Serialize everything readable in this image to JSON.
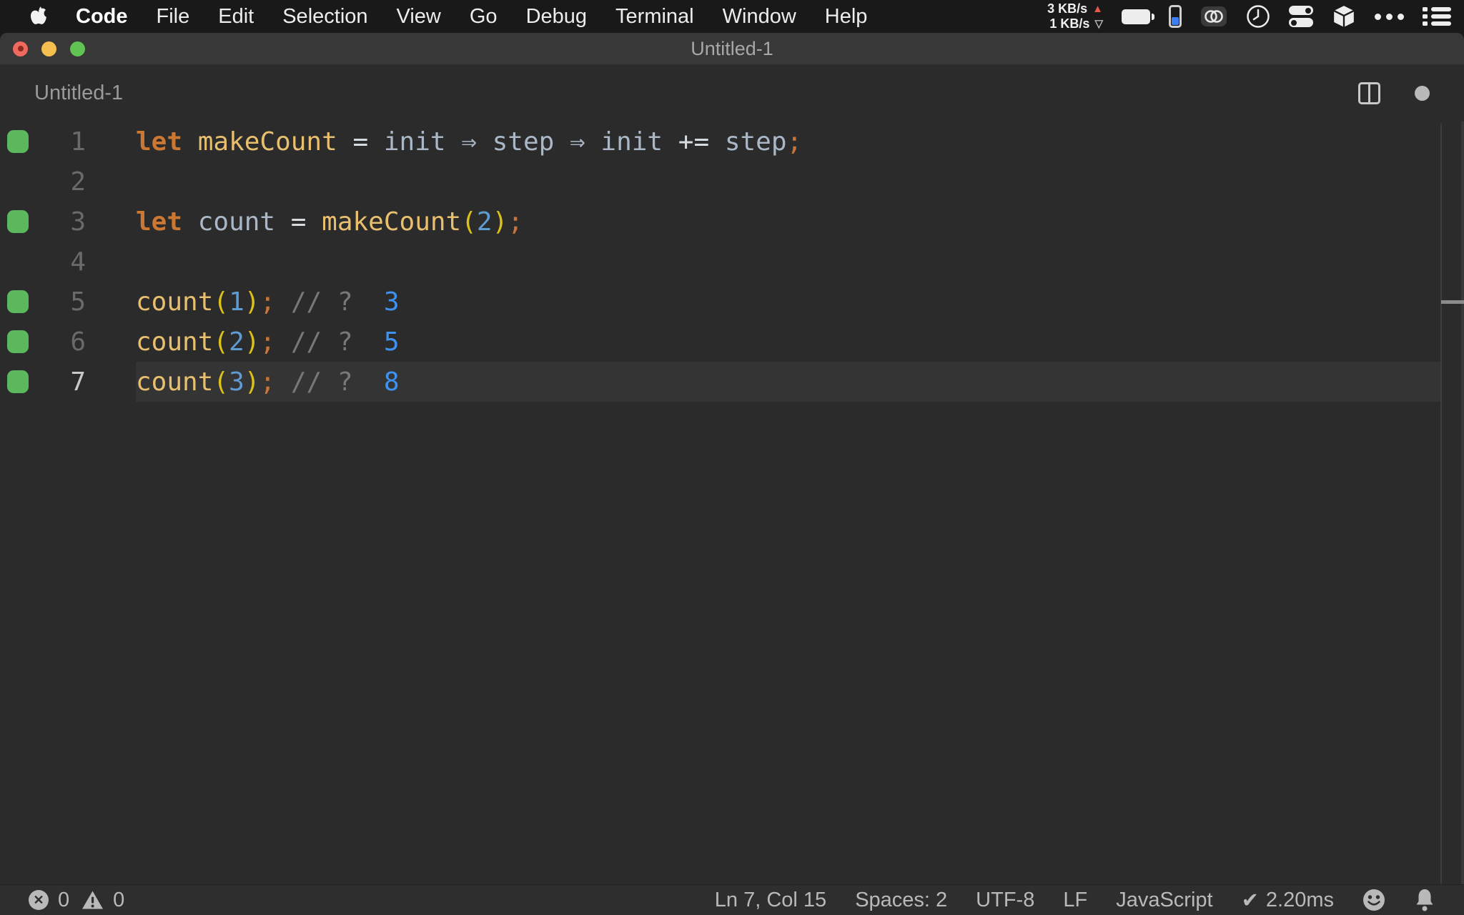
{
  "menu_bar": {
    "app_name": "Code",
    "items": [
      "File",
      "Edit",
      "Selection",
      "View",
      "Go",
      "Debug",
      "Terminal",
      "Window",
      "Help"
    ],
    "network": {
      "upload": "3 KB/s",
      "download": "1 KB/s"
    },
    "status_icons": [
      "battery-icon",
      "device-battery-icon",
      "rings-icon",
      "clock-icon",
      "toggles-icon",
      "cube-icon",
      "ellipsis-icon",
      "list-icon"
    ]
  },
  "window": {
    "title": "Untitled-1",
    "controls": [
      "close",
      "minimize",
      "zoom"
    ]
  },
  "editor": {
    "tab_label": "Untitled-1",
    "actions": [
      "split-editor-icon",
      "dirty-indicator"
    ],
    "active_line": 7,
    "lines": [
      {
        "num": "1",
        "marker": true,
        "tokens": [
          [
            "let",
            "kw"
          ],
          [
            " ",
            ""
          ],
          [
            "makeCount",
            "fn"
          ],
          [
            " ",
            ""
          ],
          [
            "=",
            "op"
          ],
          [
            " ",
            ""
          ],
          [
            "init",
            "id"
          ],
          [
            " ",
            ""
          ],
          [
            "⇒",
            "id"
          ],
          [
            " ",
            ""
          ],
          [
            "step",
            "id"
          ],
          [
            " ",
            ""
          ],
          [
            "⇒",
            "id"
          ],
          [
            " ",
            ""
          ],
          [
            "init",
            "id"
          ],
          [
            " ",
            ""
          ],
          [
            "+=",
            "op"
          ],
          [
            " ",
            ""
          ],
          [
            "step",
            "id"
          ],
          [
            ";",
            "semi"
          ]
        ]
      },
      {
        "num": "2",
        "marker": false,
        "tokens": []
      },
      {
        "num": "3",
        "marker": true,
        "tokens": [
          [
            "let",
            "kw"
          ],
          [
            " ",
            ""
          ],
          [
            "count",
            "id"
          ],
          [
            " ",
            ""
          ],
          [
            "=",
            "op"
          ],
          [
            " ",
            ""
          ],
          [
            "makeCount",
            "fn"
          ],
          [
            "(",
            "paren"
          ],
          [
            "2",
            "num"
          ],
          [
            ")",
            "paren"
          ],
          [
            ";",
            "semi"
          ]
        ]
      },
      {
        "num": "4",
        "marker": false,
        "tokens": []
      },
      {
        "num": "5",
        "marker": true,
        "tokens": [
          [
            "count",
            "fn"
          ],
          [
            "(",
            "paren"
          ],
          [
            "1",
            "num"
          ],
          [
            ")",
            "paren"
          ],
          [
            ";",
            "semi"
          ],
          [
            " ",
            ""
          ],
          [
            "//",
            "cmt"
          ],
          [
            " ",
            ""
          ],
          [
            "?",
            "cmt"
          ],
          [
            "  ",
            ""
          ],
          [
            "3",
            "res"
          ]
        ]
      },
      {
        "num": "6",
        "marker": true,
        "tokens": [
          [
            "count",
            "fn"
          ],
          [
            "(",
            "paren"
          ],
          [
            "2",
            "num"
          ],
          [
            ")",
            "paren"
          ],
          [
            ";",
            "semi"
          ],
          [
            " ",
            ""
          ],
          [
            "//",
            "cmt"
          ],
          [
            " ",
            ""
          ],
          [
            "?",
            "cmt"
          ],
          [
            "  ",
            ""
          ],
          [
            "5",
            "res"
          ]
        ]
      },
      {
        "num": "7",
        "marker": true,
        "tokens": [
          [
            "count",
            "fn"
          ],
          [
            "(",
            "paren"
          ],
          [
            "3",
            "num"
          ],
          [
            ")",
            "paren"
          ],
          [
            ";",
            "semi"
          ],
          [
            " ",
            ""
          ],
          [
            "//",
            "cmt"
          ],
          [
            " ",
            ""
          ],
          [
            "?",
            "cmt"
          ],
          [
            "  ",
            ""
          ],
          [
            "8",
            "res"
          ]
        ]
      }
    ]
  },
  "status_bar": {
    "errors": "0",
    "warnings": "0",
    "cursor_position": "Ln 7, Col 15",
    "indentation": "Spaces: 2",
    "encoding": "UTF-8",
    "eol": "LF",
    "language": "JavaScript",
    "check": "✔",
    "run_time": "2.20ms"
  },
  "colors": {
    "menubar_bg": "#191919",
    "titlebar_bg": "#383838",
    "editor_bg": "#2b2b2b",
    "statusbar_bg": "#2e2e2e",
    "current_line_bg": "#343434",
    "keyword": "#cc7832",
    "function_name": "#e8bf6e",
    "identifier": "#a9b7c6",
    "operator": "#d6dbe0",
    "paren": "#ddc118",
    "number_literal": "#5f9bd3",
    "semicolon": "#c8743c",
    "comment": "#787878",
    "inline_result": "#3e93f2",
    "line_number": "#6a6a6a",
    "active_line_number": "#c9c9c9",
    "coverage_green": "#5cb85c",
    "traffic_red": "#ee6a5e",
    "traffic_yellow": "#f5bf4f",
    "traffic_green": "#61c354",
    "net_up": "#e4584c",
    "battery_blue": "#3d7ff0"
  }
}
